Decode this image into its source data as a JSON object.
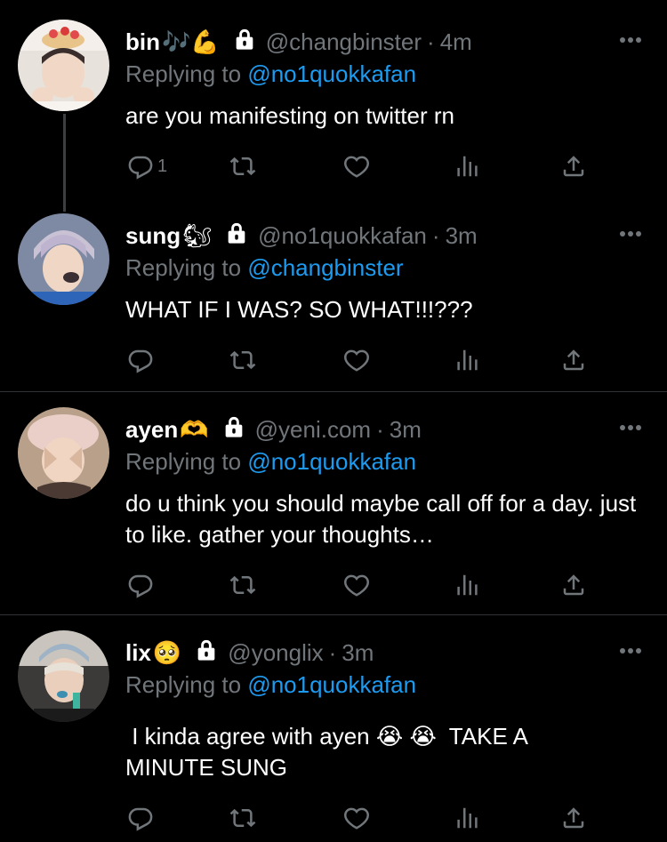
{
  "colors": {
    "background": "#000000",
    "text": "#ffffff",
    "muted": "#71767b",
    "link": "#1d9bf0",
    "divider": "#2f3336"
  },
  "icons": [
    "lock-icon",
    "more-icon",
    "reply-icon",
    "retweet-icon",
    "like-icon",
    "analytics-icon",
    "share-icon"
  ],
  "tweets": [
    {
      "name": "bin",
      "emoji": "🎶💪",
      "handle": "@changbinster",
      "separator": "·",
      "time": "4m",
      "replying_label": "Replying to",
      "replying_to": "@no1quokkafan",
      "text": "are you manifesting on twitter rn",
      "reply_count": "1"
    },
    {
      "name": "sung",
      "emoji": "🐿",
      "handle": "@no1quokkafan",
      "separator": "·",
      "time": "3m",
      "replying_label": "Replying to",
      "replying_to": "@changbinster",
      "text": "WHAT IF I WAS? SO WHAT!!!???",
      "reply_count": ""
    },
    {
      "name": "ayen",
      "emoji": "🫶",
      "handle": "@yeni.com",
      "separator": "·",
      "time": "3m",
      "replying_label": "Replying to",
      "replying_to": "@no1quokkafan",
      "text": "do u think you should maybe call off for a day. just to like. gather your thoughts…",
      "reply_count": ""
    },
    {
      "name": "lix",
      "emoji": "🥺",
      "handle": "@yonglix",
      "separator": "·",
      "time": "3m",
      "replying_label": "Replying to",
      "replying_to": "@no1quokkafan",
      "text": " I kinda agree with ayen 😭 😭  TAKE A MINUTE SUNG",
      "reply_count": ""
    }
  ]
}
